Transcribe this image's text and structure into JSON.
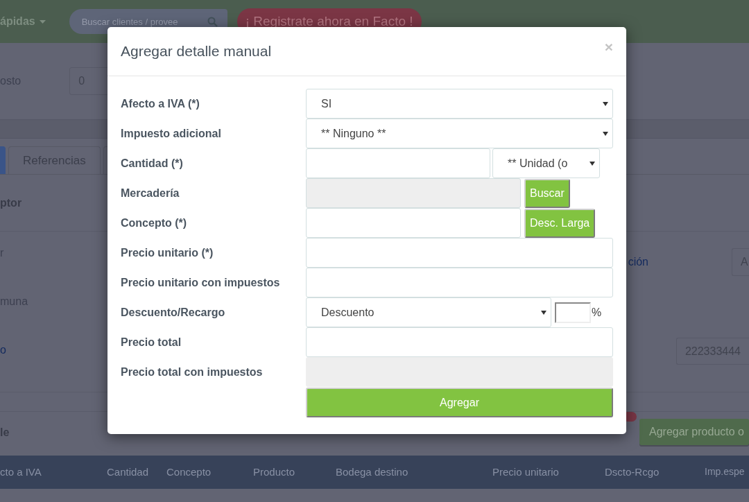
{
  "top_bar": {
    "menu": "ápidas",
    "search": {
      "placeholder": "Buscar clientes / provee"
    },
    "promo": "¡ Registrate ahora en Facto !"
  },
  "page": {
    "cost_label": "osto",
    "cost_value": "0",
    "tabs": [
      {
        "selected": true
      },
      {
        "label": "Referencias",
        "selected": false
      }
    ],
    "section_title": "ptor",
    "left_labels": [
      {
        "text": "r",
        "kind": "label"
      },
      {
        "text": "muna",
        "kind": "label"
      },
      {
        "text": "o",
        "kind": "link"
      }
    ],
    "right_label": "ción",
    "right_value": "A",
    "phone_value": "222333444",
    "detail_title": "le",
    "add_button": "Agregar producto o",
    "table_columns": [
      "cto a IVA",
      "Cantidad",
      "Concepto",
      "Producto",
      "Bodega destino",
      "Precio unitario",
      "Dscto-Rcgo",
      "Imp.espe"
    ]
  },
  "modal": {
    "title": "Agregar detalle manual",
    "close": "×",
    "rows": [
      {
        "label": "Afecto a IVA (*)",
        "kind": "select",
        "value": "SI"
      },
      {
        "label": "Impuesto adicional",
        "kind": "select",
        "value": "** Ninguno **"
      },
      {
        "label": "Cantidad (*)",
        "kind": "input_unit",
        "unit": "** Unidad (o"
      },
      {
        "label": "Mercadería",
        "kind": "readonly_button",
        "button": "Buscar"
      },
      {
        "label": "Concepto (*)",
        "kind": "input_button",
        "button": "Desc. Larga"
      },
      {
        "label": "Precio unitario (*)",
        "kind": "input"
      },
      {
        "label": "Precio unitario con impuestos",
        "kind": "input"
      },
      {
        "label": "Descuento/Recargo",
        "kind": "select_percent",
        "value": "Descuento",
        "suffix": "%"
      },
      {
        "label": "Precio total",
        "kind": "input"
      },
      {
        "label": "Precio total con impuestos",
        "kind": "readonly"
      }
    ],
    "submit": "Agregar"
  }
}
